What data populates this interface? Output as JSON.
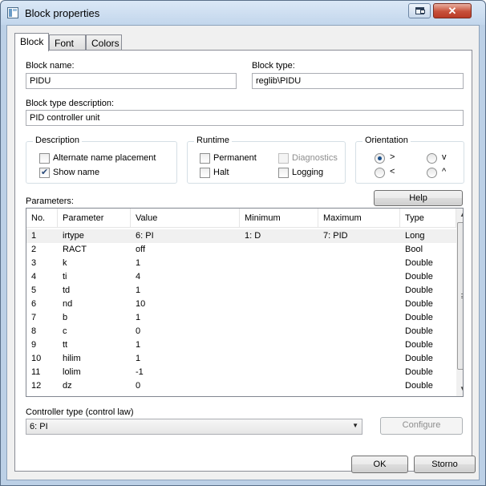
{
  "window": {
    "title": "Block properties",
    "close_glyph": "✕"
  },
  "tabs": [
    {
      "label": "Block"
    },
    {
      "label": "Font"
    },
    {
      "label": "Colors"
    }
  ],
  "block_name": {
    "label": "Block name:",
    "value": "PIDU"
  },
  "block_type": {
    "label": "Block type:",
    "value": "reglib\\PIDU"
  },
  "block_type_description": {
    "label": "Block type description:",
    "value": "PID controller unit"
  },
  "description_group": {
    "title": "Description",
    "alternate_name_placement": {
      "label": "Alternate name placement",
      "checked": false
    },
    "show_name": {
      "label": "Show name",
      "checked": true
    }
  },
  "runtime_group": {
    "title": "Runtime",
    "permanent": {
      "label": "Permanent",
      "checked": false
    },
    "diagnostics": {
      "label": "Diagnostics",
      "checked": false,
      "enabled": false
    },
    "halt": {
      "label": "Halt",
      "checked": false
    },
    "logging": {
      "label": "Logging",
      "checked": false
    }
  },
  "orientation_group": {
    "title": "Orientation",
    "options": [
      {
        "label": ">",
        "selected": true
      },
      {
        "label": "v",
        "selected": false
      },
      {
        "label": "<",
        "selected": false
      },
      {
        "label": "^",
        "selected": false
      }
    ]
  },
  "parameters": {
    "label": "Parameters:",
    "help_label": "Help",
    "columns": [
      "No.",
      "Parameter",
      "Value",
      "Minimum",
      "Maximum",
      "Type"
    ],
    "rows": [
      [
        "1",
        "irtype",
        "6: PI",
        "1: D",
        "7: PID",
        "Long"
      ],
      [
        "2",
        "RACT",
        "off",
        "",
        "",
        "Bool"
      ],
      [
        "3",
        "k",
        "1",
        "",
        "",
        "Double"
      ],
      [
        "4",
        "ti",
        "4",
        "",
        "",
        "Double"
      ],
      [
        "5",
        "td",
        "1",
        "",
        "",
        "Double"
      ],
      [
        "6",
        "nd",
        "10",
        "",
        "",
        "Double"
      ],
      [
        "7",
        "b",
        "1",
        "",
        "",
        "Double"
      ],
      [
        "8",
        "c",
        "0",
        "",
        "",
        "Double"
      ],
      [
        "9",
        "tt",
        "1",
        "",
        "",
        "Double"
      ],
      [
        "10",
        "hilim",
        "1",
        "",
        "",
        "Double"
      ],
      [
        "11",
        "lolim",
        "-1",
        "",
        "",
        "Double"
      ],
      [
        "12",
        "dz",
        "0",
        "",
        "",
        "Double"
      ]
    ]
  },
  "controller_type": {
    "label": "Controller type (control law)",
    "value": "6: PI"
  },
  "buttons": {
    "configure": "Configure",
    "ok": "OK",
    "cancel": "Storno"
  },
  "icons": {
    "app": "window-app-icon",
    "restore": "restore-icon",
    "close": "close-icon",
    "dropdown": "chevron-down-icon"
  }
}
